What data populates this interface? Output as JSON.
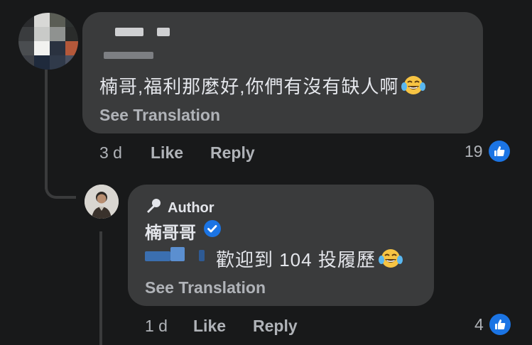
{
  "comment": {
    "text": "楠哥,福利那麼好,你們有沒有缺人啊",
    "emoji": "laughing-tears-emoji",
    "see_translation": "See Translation",
    "time": "3 d",
    "like_label": "Like",
    "reply_label": "Reply",
    "reactions": "19"
  },
  "reply": {
    "badge": "Author",
    "author_name": "楠哥哥",
    "verified_icon": "verified-badge-icon",
    "text": "歡迎到 104 投履歷",
    "emoji": "laughing-tears-emoji",
    "see_translation": "See Translation",
    "time": "1 d",
    "like_label": "Like",
    "reply_label": "Reply",
    "reactions": "4"
  },
  "colors": {
    "background": "#18191a",
    "bubble": "#3a3b3c",
    "text": "#e4e6eb",
    "secondary_text": "#b0b3b8",
    "accent": "#1b74e4"
  }
}
